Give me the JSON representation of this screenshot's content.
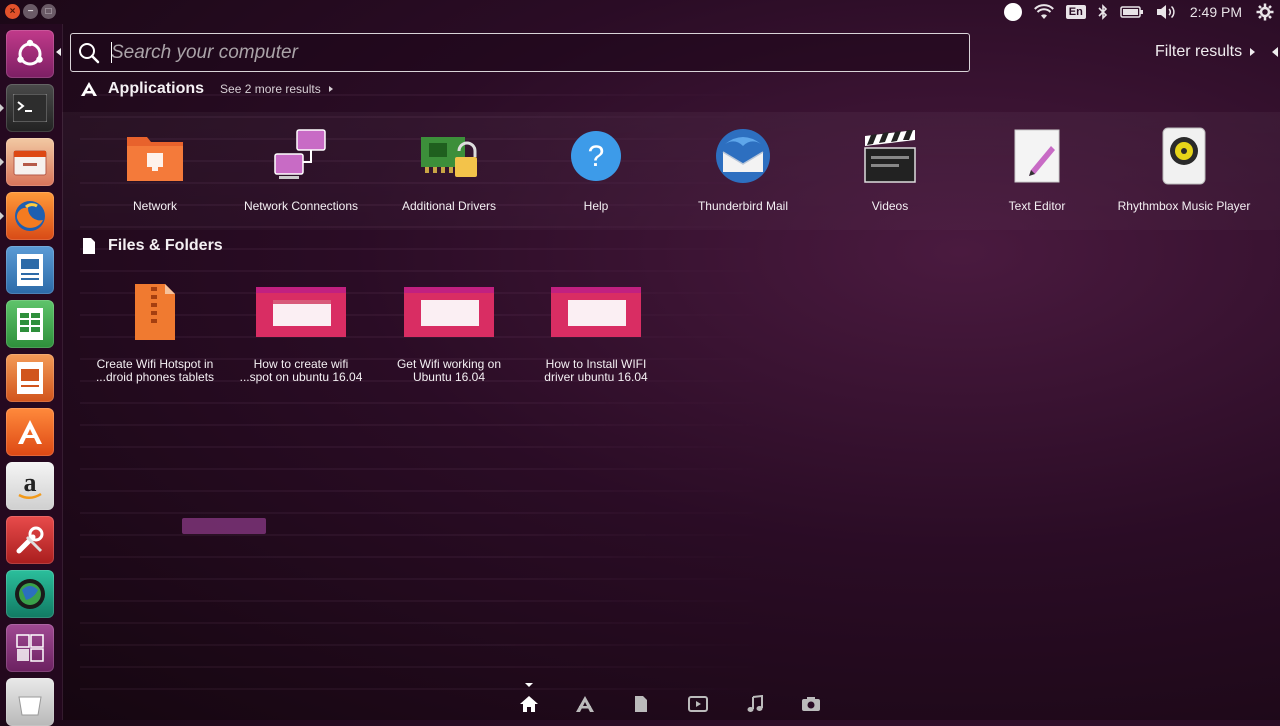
{
  "top_panel": {
    "keyboard_layout": "En",
    "clock": "2:49 PM",
    "icons": [
      "record-icon",
      "wifi-icon",
      "keyboard-layout-icon",
      "bluetooth-icon",
      "battery-icon",
      "volume-icon",
      "system-gear-icon"
    ]
  },
  "window_controls": {
    "close": "×",
    "minimize": "−",
    "maximize": "□"
  },
  "launcher": {
    "items": [
      {
        "name": "dash-home",
        "icon": "ubuntu-dash-icon"
      },
      {
        "name": "terminal",
        "icon": "terminal-icon"
      },
      {
        "name": "files",
        "icon": "files-icon"
      },
      {
        "name": "firefox",
        "icon": "firefox-icon"
      },
      {
        "name": "libreoffice-writer",
        "icon": "writer-icon"
      },
      {
        "name": "libreoffice-calc",
        "icon": "calc-icon"
      },
      {
        "name": "libreoffice-impress",
        "icon": "impress-icon"
      },
      {
        "name": "software-center",
        "icon": "software-center-icon"
      },
      {
        "name": "amazon",
        "icon": "amazon-icon"
      },
      {
        "name": "system-settings",
        "icon": "settings-icon"
      },
      {
        "name": "globe-app",
        "icon": "globe-icon"
      },
      {
        "name": "workspaces",
        "icon": "workspaces-icon"
      },
      {
        "name": "trash",
        "icon": "trash-icon"
      }
    ]
  },
  "search": {
    "placeholder": "Search your computer",
    "value": ""
  },
  "filter": {
    "label": "Filter results"
  },
  "applications": {
    "title": "Applications",
    "see_more": "See 2 more results",
    "items": [
      {
        "label": "Network",
        "icon": "network-folder-icon"
      },
      {
        "label": "Network Connections",
        "icon": "network-connections-icon"
      },
      {
        "label": "Additional Drivers",
        "icon": "additional-drivers-icon"
      },
      {
        "label": "Help",
        "icon": "help-icon"
      },
      {
        "label": "Thunderbird Mail",
        "icon": "thunderbird-icon"
      },
      {
        "label": "Videos",
        "icon": "videos-icon"
      },
      {
        "label": "Text Editor",
        "icon": "text-editor-icon"
      },
      {
        "label": "Rhythmbox Music Player",
        "icon": "rhythmbox-icon"
      }
    ]
  },
  "files_folders": {
    "title": "Files & Folders",
    "items": [
      {
        "label_line1": "Create Wifi Hotspot in",
        "label_line2": "...droid phones tablets",
        "icon": "archive-file-icon"
      },
      {
        "label_line1": "How to create wifi",
        "label_line2": "...spot on ubuntu 16.04",
        "icon": "video-thumbnail-icon"
      },
      {
        "label_line1": "Get Wifi working on",
        "label_line2": "Ubuntu 16.04",
        "icon": "video-thumbnail-icon"
      },
      {
        "label_line1": "How to Install WIFI",
        "label_line2": "driver ubuntu 16.04",
        "icon": "video-thumbnail-icon"
      }
    ]
  },
  "lenses": [
    "home-lens-icon",
    "applications-lens-icon",
    "files-lens-icon",
    "videos-lens-icon",
    "music-lens-icon",
    "photos-lens-icon"
  ],
  "colors": {
    "accent": "#dd4814",
    "background": "#2a0c25",
    "launcher": "#280a22"
  }
}
